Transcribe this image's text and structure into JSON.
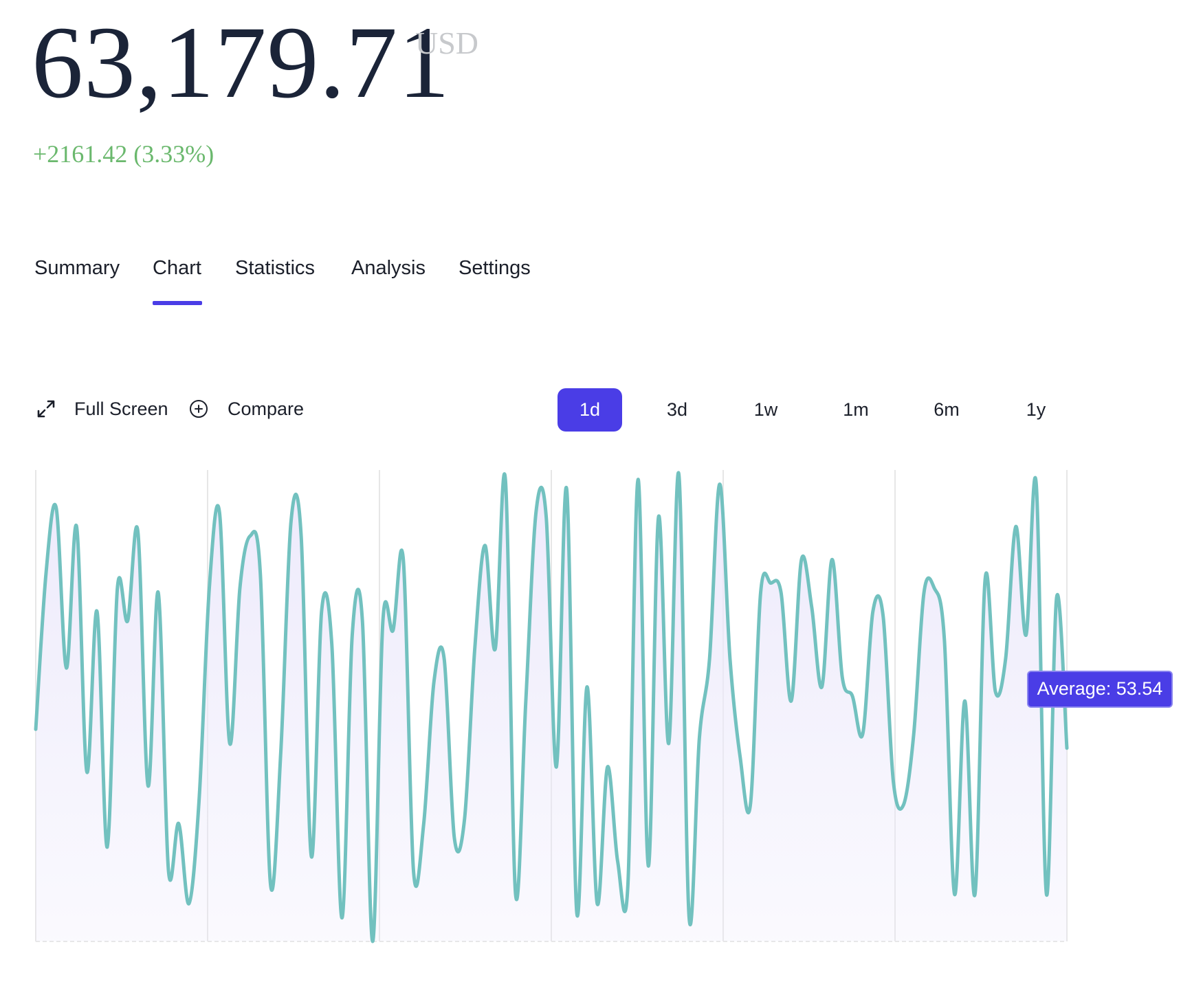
{
  "quote": {
    "price": "63,179.71",
    "currency": "USD",
    "change": "+2161.42 (3.33%)"
  },
  "tabs": [
    {
      "label": "Summary",
      "active": false
    },
    {
      "label": "Chart",
      "active": true
    },
    {
      "label": "Statistics",
      "active": false
    },
    {
      "label": "Analysis",
      "active": false
    },
    {
      "label": "Settings",
      "active": false
    }
  ],
  "toolbar": {
    "fullscreen_label": "Full Screen",
    "fullscreen_icon": "expand-arrows-icon",
    "compare_label": "Compare",
    "compare_icon": "plus-circle-icon"
  },
  "ranges": [
    {
      "label": "1d",
      "active": true
    },
    {
      "label": "3d",
      "active": false
    },
    {
      "label": "1w",
      "active": false
    },
    {
      "label": "1m",
      "active": false
    },
    {
      "label": "6m",
      "active": false
    },
    {
      "label": "1y",
      "active": false
    }
  ],
  "colors": {
    "accent": "#4a3de6",
    "positive": "#6ab86d",
    "line": "#72c1bf",
    "area": "#ece9fb",
    "grid": "#e6e6e6",
    "price": "#1b2438"
  },
  "chart_data": {
    "type": "area",
    "average_label": "Average: 53.54",
    "average": 53.54,
    "grid": true,
    "ylim": [
      0,
      100
    ],
    "y": [
      45,
      78,
      92,
      58,
      88,
      36,
      70,
      20,
      75,
      68,
      87,
      33,
      74,
      15,
      25,
      8,
      30,
      75,
      91,
      42,
      75,
      86,
      78,
      12,
      40,
      89,
      86,
      18,
      70,
      63,
      5,
      65,
      68,
      0,
      68,
      66,
      81,
      15,
      25,
      55,
      60,
      22,
      26,
      62,
      84,
      62,
      98,
      10,
      51,
      91,
      90,
      37,
      96,
      6,
      54,
      8,
      37,
      17,
      12,
      98,
      16,
      90,
      42,
      99,
      5,
      43,
      60,
      97,
      60,
      39,
      29,
      74,
      76,
      74,
      51,
      81,
      71,
      54,
      81,
      56,
      52,
      44,
      70,
      69,
      34,
      29,
      44,
      74,
      75,
      64,
      10,
      51,
      10,
      77,
      53,
      60,
      88,
      65,
      97,
      10,
      73,
      41
    ]
  }
}
